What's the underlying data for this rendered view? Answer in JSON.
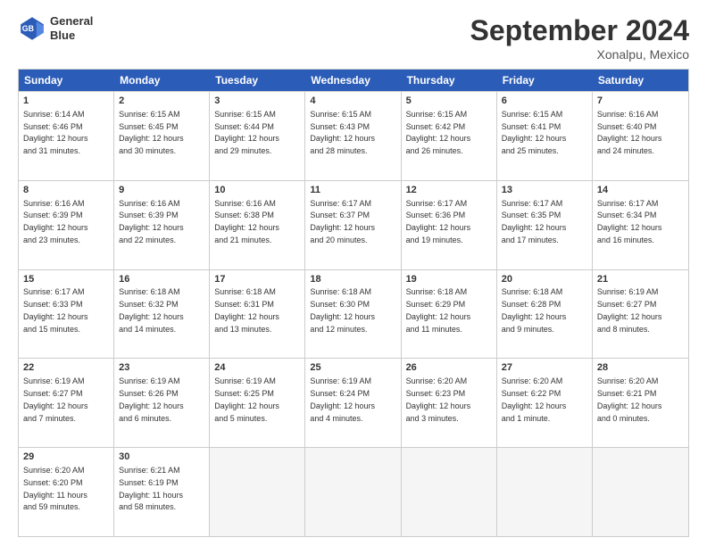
{
  "header": {
    "logo_line1": "General",
    "logo_line2": "Blue",
    "title": "September 2024",
    "subtitle": "Xonalpu, Mexico"
  },
  "days": [
    "Sunday",
    "Monday",
    "Tuesday",
    "Wednesday",
    "Thursday",
    "Friday",
    "Saturday"
  ],
  "weeks": [
    [
      {
        "num": "1",
        "rise": "6:14 AM",
        "set": "6:46 PM",
        "hours": "12 hours and 31 minutes."
      },
      {
        "num": "2",
        "rise": "6:15 AM",
        "set": "6:45 PM",
        "hours": "12 hours and 30 minutes."
      },
      {
        "num": "3",
        "rise": "6:15 AM",
        "set": "6:44 PM",
        "hours": "12 hours and 29 minutes."
      },
      {
        "num": "4",
        "rise": "6:15 AM",
        "set": "6:43 PM",
        "hours": "12 hours and 28 minutes."
      },
      {
        "num": "5",
        "rise": "6:15 AM",
        "set": "6:42 PM",
        "hours": "12 hours and 26 minutes."
      },
      {
        "num": "6",
        "rise": "6:15 AM",
        "set": "6:41 PM",
        "hours": "12 hours and 25 minutes."
      },
      {
        "num": "7",
        "rise": "6:16 AM",
        "set": "6:40 PM",
        "hours": "12 hours and 24 minutes."
      }
    ],
    [
      {
        "num": "8",
        "rise": "6:16 AM",
        "set": "6:39 PM",
        "hours": "12 hours and 23 minutes."
      },
      {
        "num": "9",
        "rise": "6:16 AM",
        "set": "6:39 PM",
        "hours": "12 hours and 22 minutes."
      },
      {
        "num": "10",
        "rise": "6:16 AM",
        "set": "6:38 PM",
        "hours": "12 hours and 21 minutes."
      },
      {
        "num": "11",
        "rise": "6:17 AM",
        "set": "6:37 PM",
        "hours": "12 hours and 20 minutes."
      },
      {
        "num": "12",
        "rise": "6:17 AM",
        "set": "6:36 PM",
        "hours": "12 hours and 19 minutes."
      },
      {
        "num": "13",
        "rise": "6:17 AM",
        "set": "6:35 PM",
        "hours": "12 hours and 17 minutes."
      },
      {
        "num": "14",
        "rise": "6:17 AM",
        "set": "6:34 PM",
        "hours": "12 hours and 16 minutes."
      }
    ],
    [
      {
        "num": "15",
        "rise": "6:17 AM",
        "set": "6:33 PM",
        "hours": "12 hours and 15 minutes."
      },
      {
        "num": "16",
        "rise": "6:18 AM",
        "set": "6:32 PM",
        "hours": "12 hours and 14 minutes."
      },
      {
        "num": "17",
        "rise": "6:18 AM",
        "set": "6:31 PM",
        "hours": "12 hours and 13 minutes."
      },
      {
        "num": "18",
        "rise": "6:18 AM",
        "set": "6:30 PM",
        "hours": "12 hours and 12 minutes."
      },
      {
        "num": "19",
        "rise": "6:18 AM",
        "set": "6:29 PM",
        "hours": "12 hours and 11 minutes."
      },
      {
        "num": "20",
        "rise": "6:18 AM",
        "set": "6:28 PM",
        "hours": "12 hours and 9 minutes."
      },
      {
        "num": "21",
        "rise": "6:19 AM",
        "set": "6:27 PM",
        "hours": "12 hours and 8 minutes."
      }
    ],
    [
      {
        "num": "22",
        "rise": "6:19 AM",
        "set": "6:27 PM",
        "hours": "12 hours and 7 minutes."
      },
      {
        "num": "23",
        "rise": "6:19 AM",
        "set": "6:26 PM",
        "hours": "12 hours and 6 minutes."
      },
      {
        "num": "24",
        "rise": "6:19 AM",
        "set": "6:25 PM",
        "hours": "12 hours and 5 minutes."
      },
      {
        "num": "25",
        "rise": "6:19 AM",
        "set": "6:24 PM",
        "hours": "12 hours and 4 minutes."
      },
      {
        "num": "26",
        "rise": "6:20 AM",
        "set": "6:23 PM",
        "hours": "12 hours and 3 minutes."
      },
      {
        "num": "27",
        "rise": "6:20 AM",
        "set": "6:22 PM",
        "hours": "12 hours and 1 minute."
      },
      {
        "num": "28",
        "rise": "6:20 AM",
        "set": "6:21 PM",
        "hours": "12 hours and 0 minutes."
      }
    ],
    [
      {
        "num": "29",
        "rise": "6:20 AM",
        "set": "6:20 PM",
        "hours": "11 hours and 59 minutes."
      },
      {
        "num": "30",
        "rise": "6:21 AM",
        "set": "6:19 PM",
        "hours": "11 hours and 58 minutes."
      },
      null,
      null,
      null,
      null,
      null
    ]
  ]
}
